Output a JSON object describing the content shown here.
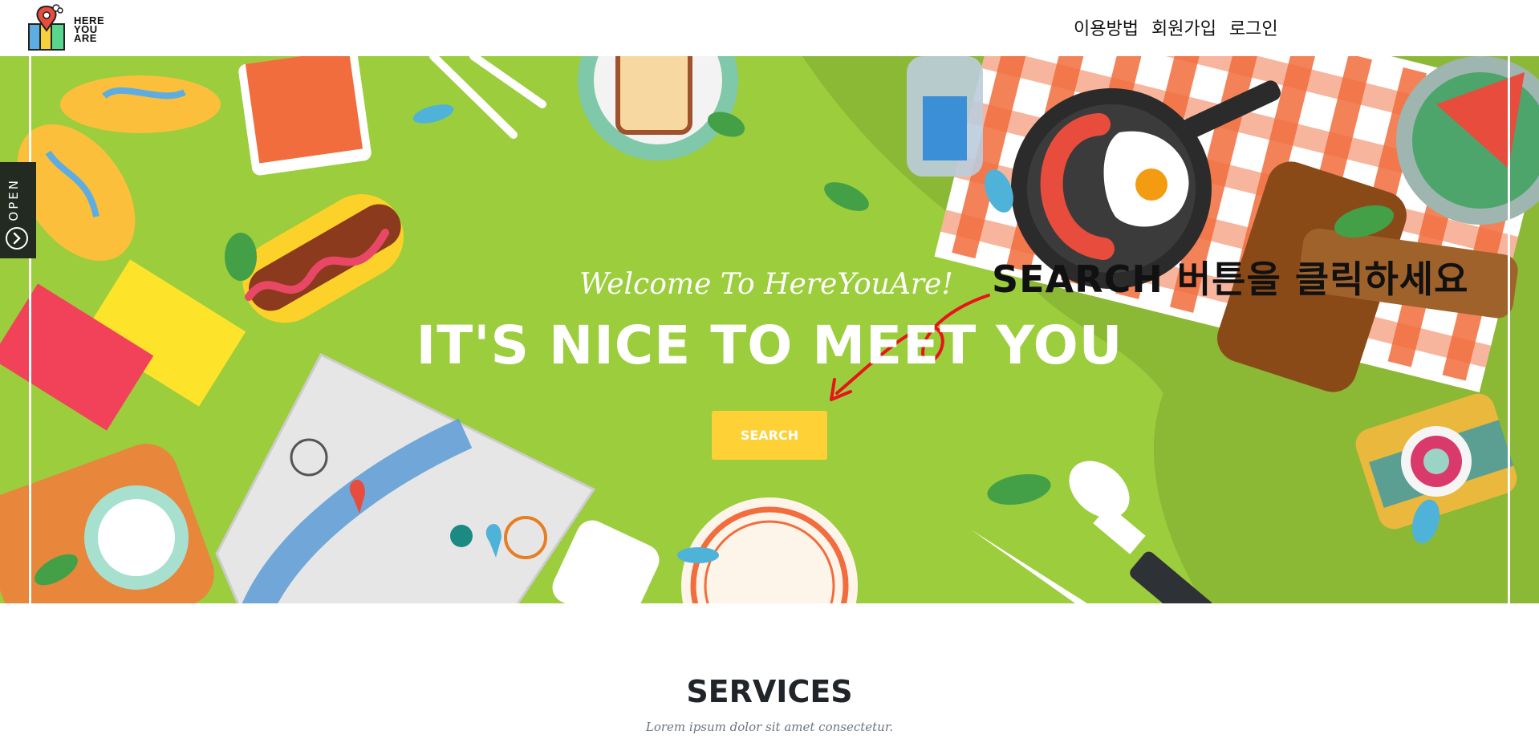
{
  "header": {
    "logo_lines": [
      "HERE",
      "YOU",
      "ARE"
    ],
    "nav": [
      "이용방법",
      "회원가입",
      "로그인"
    ]
  },
  "sidebar_tab": {
    "label": "OPEN"
  },
  "hero": {
    "welcome": "Welcome To HereYouAre!",
    "headline": "IT'S NICE TO MEET YOU",
    "search_button": "SEARCH",
    "annotation": "SEARCH 버튼을 클릭하세요"
  },
  "services": {
    "title": "SERVICES",
    "subtitle": "Lorem ipsum dolor sit amet consectetur."
  },
  "colors": {
    "hero_green": "#9bcd3c",
    "button_yellow": "#fed136",
    "annotation_arrow": "#e8141c"
  }
}
